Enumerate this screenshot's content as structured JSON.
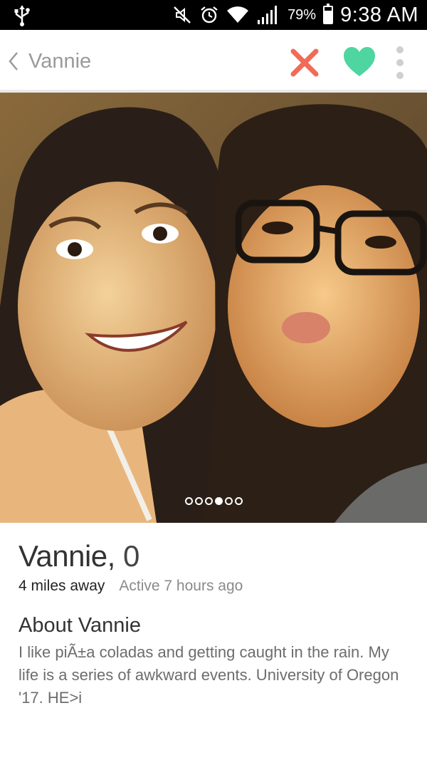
{
  "status_bar": {
    "battery": "79%",
    "battery_level": 0.79,
    "time": "9:38 AM",
    "icons": [
      "usb-icon",
      "mute-icon",
      "alarm-icon",
      "wifi-icon",
      "signal-icon",
      "battery-icon"
    ]
  },
  "header": {
    "back_label": "Vannie",
    "actions": [
      "close-icon",
      "heart-icon",
      "more-vert-icon"
    ]
  },
  "colors": {
    "nope": "#f26b59",
    "like": "#4fd6a0",
    "muted": "#9a9a9a"
  },
  "photo": {
    "page_count": 6,
    "active_index": 3
  },
  "profile": {
    "name": "Vannie",
    "age": "0",
    "distance": "4 miles away",
    "active": "Active 7 hours ago",
    "about_title": "About Vannie",
    "about_text": "I like piÃ±a coladas and getting caught in the rain. My life is a series of awkward events. University of Oregon '17. HE>i"
  }
}
